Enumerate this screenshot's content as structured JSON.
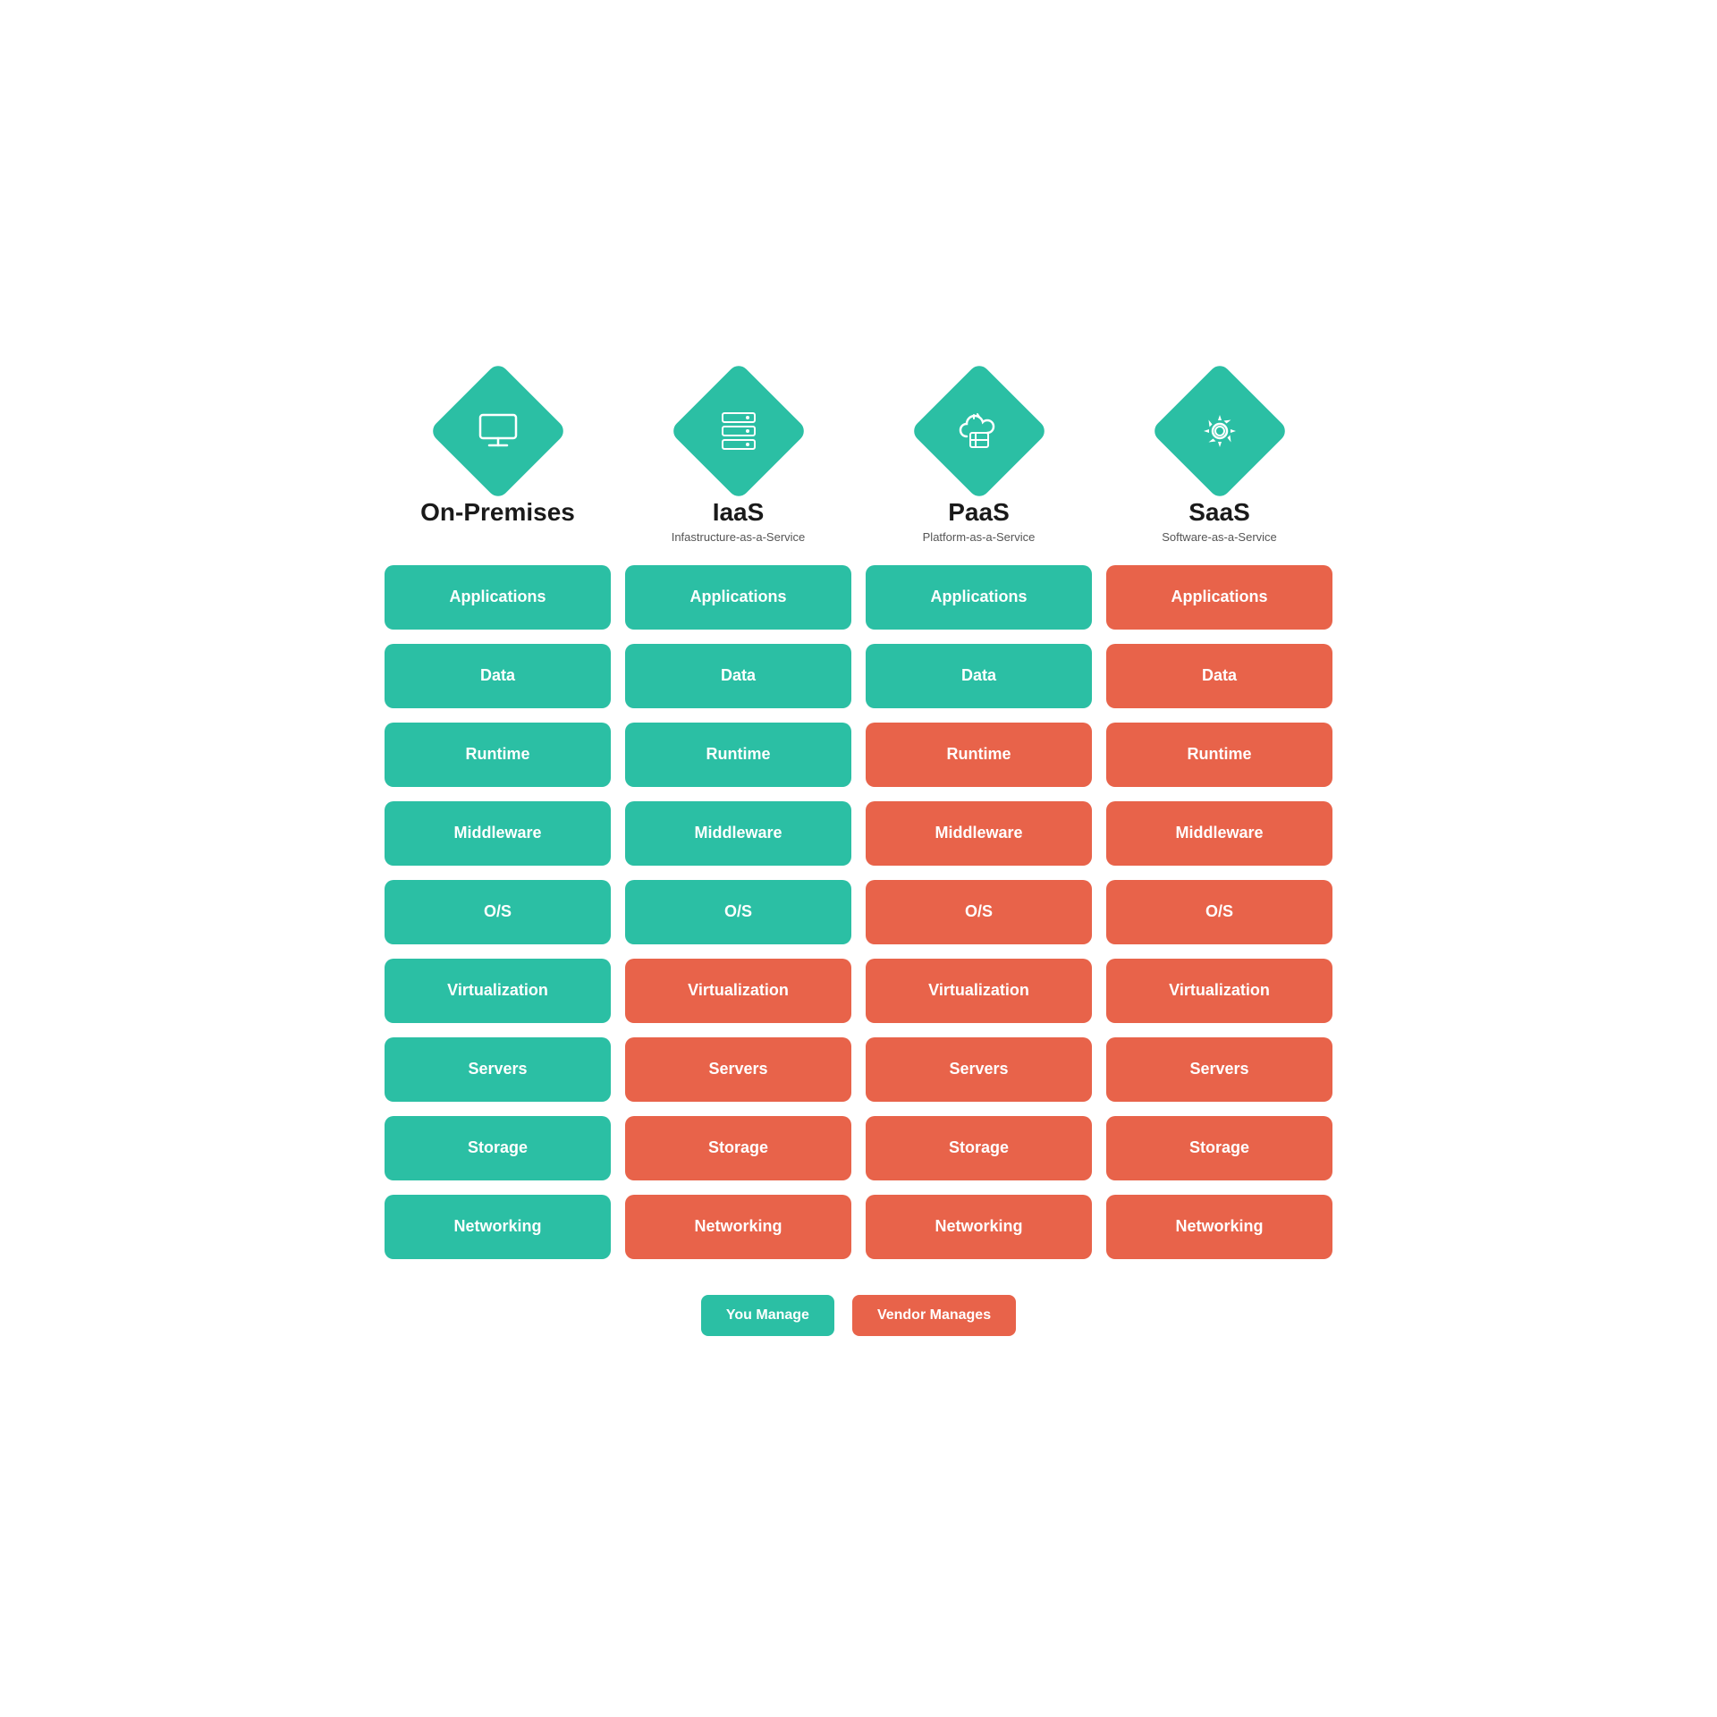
{
  "columns": [
    {
      "id": "on-premises",
      "title": "On-Premises",
      "subtitle": "",
      "icon": "monitor",
      "rows": [
        {
          "label": "Applications",
          "color": "green"
        },
        {
          "label": "Data",
          "color": "green"
        },
        {
          "label": "Runtime",
          "color": "green"
        },
        {
          "label": "Middleware",
          "color": "green"
        },
        {
          "label": "O/S",
          "color": "green"
        },
        {
          "label": "Virtualization",
          "color": "green"
        },
        {
          "label": "Servers",
          "color": "green"
        },
        {
          "label": "Storage",
          "color": "green"
        },
        {
          "label": "Networking",
          "color": "green"
        }
      ]
    },
    {
      "id": "iaas",
      "title": "IaaS",
      "subtitle": "Infastructure-as-a-Service",
      "icon": "server",
      "rows": [
        {
          "label": "Applications",
          "color": "green"
        },
        {
          "label": "Data",
          "color": "green"
        },
        {
          "label": "Runtime",
          "color": "green"
        },
        {
          "label": "Middleware",
          "color": "green"
        },
        {
          "label": "O/S",
          "color": "green"
        },
        {
          "label": "Virtualization",
          "color": "orange"
        },
        {
          "label": "Servers",
          "color": "orange"
        },
        {
          "label": "Storage",
          "color": "orange"
        },
        {
          "label": "Networking",
          "color": "orange"
        }
      ]
    },
    {
      "id": "paas",
      "title": "PaaS",
      "subtitle": "Platform-as-a-Service",
      "icon": "cloud",
      "rows": [
        {
          "label": "Applications",
          "color": "green"
        },
        {
          "label": "Data",
          "color": "green"
        },
        {
          "label": "Runtime",
          "color": "orange"
        },
        {
          "label": "Middleware",
          "color": "orange"
        },
        {
          "label": "O/S",
          "color": "orange"
        },
        {
          "label": "Virtualization",
          "color": "orange"
        },
        {
          "label": "Servers",
          "color": "orange"
        },
        {
          "label": "Storage",
          "color": "orange"
        },
        {
          "label": "Networking",
          "color": "orange"
        }
      ]
    },
    {
      "id": "saas",
      "title": "SaaS",
      "subtitle": "Software-as-a-Service",
      "icon": "gear",
      "rows": [
        {
          "label": "Applications",
          "color": "orange"
        },
        {
          "label": "Data",
          "color": "orange"
        },
        {
          "label": "Runtime",
          "color": "orange"
        },
        {
          "label": "Middleware",
          "color": "orange"
        },
        {
          "label": "O/S",
          "color": "orange"
        },
        {
          "label": "Virtualization",
          "color": "orange"
        },
        {
          "label": "Servers",
          "color": "orange"
        },
        {
          "label": "Storage",
          "color": "orange"
        },
        {
          "label": "Networking",
          "color": "orange"
        }
      ]
    }
  ],
  "legend": {
    "you_manage": "You Manage",
    "vendor_manages": "Vendor Manages"
  }
}
